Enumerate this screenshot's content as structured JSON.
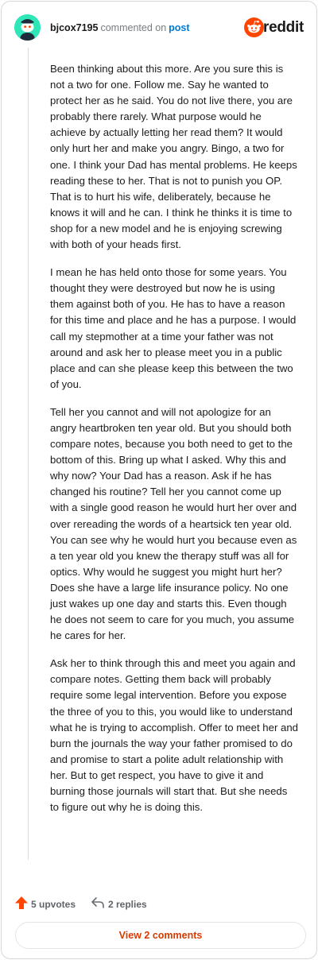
{
  "comment": {
    "username": "bjcox7195",
    "action_text": "commented on",
    "post_link": "post",
    "paragraphs": [
      "Been thinking about this more. Are you sure this is not a two for one. Follow me. Say he wanted to protect her as he said. You do not live there, you are probably there rarely. What purpose would he achieve by actually letting her read them? It would only hurt her and make you angry. Bingo, a two for one. I think your Dad has mental problems. He keeps reading these to her. That is not to punish you OP. That is to hurt his wife, deliberately, because he knows it will and he can. I think he thinks it is time to shop for a new model and he is enjoying screwing with both of your heads first.",
      "I mean he has held onto those for some years. You thought they were destroyed but now he is using them against both of you. He has to have a reason for this time and place and he has a purpose. I would call my stepmother at a time your father was not around and ask her to please meet you in a public place and can she please keep this between the two of you.",
      "Tell her you cannot and will not apologize for an angry heartbroken ten year old. But you should both compare notes, because you both need to get to the bottom of this. Bring up what I asked. Why this and why now? Your Dad has a reason. Ask if he has changed his routine? Tell her you cannot come up with a single good reason he would hurt her over and over rereading the words of a heartsick ten year old. You can see why he would hurt you because even as a ten year old you knew the therapy stuff was all for optics. Why would he suggest you might hurt her? Does she have a large life insurance policy. No one just wakes up one day and starts this. Even though he does not seem to care for you much, you assume he cares for her.",
      "Ask her to think through this and meet you again and compare notes. Getting them back will probably require some legal intervention. Before you expose the three of you to this, you would like to understand what he is trying to accomplish. Offer to meet her and burn the journals the way your father promised to do and promise to start a polite adult relationship with her. But to get respect, you have to give it and burning those journals will start that. But she needs to figure out why he is doing this."
    ],
    "upvotes_label": "5 upvotes",
    "replies_label": "2 replies",
    "view_comments_label": "View 2 comments"
  },
  "brand": {
    "wordmark": "reddit"
  },
  "icons": {
    "avatar": "snoo-avatar-icon",
    "brand": "reddit-logo-icon",
    "upvote": "upvote-arrow-icon",
    "reply": "reply-arrow-icon"
  },
  "colors": {
    "avatar_bg": "#2ee6b8",
    "brand_orange": "#ff4500",
    "link_blue": "#0079d3",
    "upvote_orange": "#ff4500",
    "button_text": "#d93a00"
  }
}
